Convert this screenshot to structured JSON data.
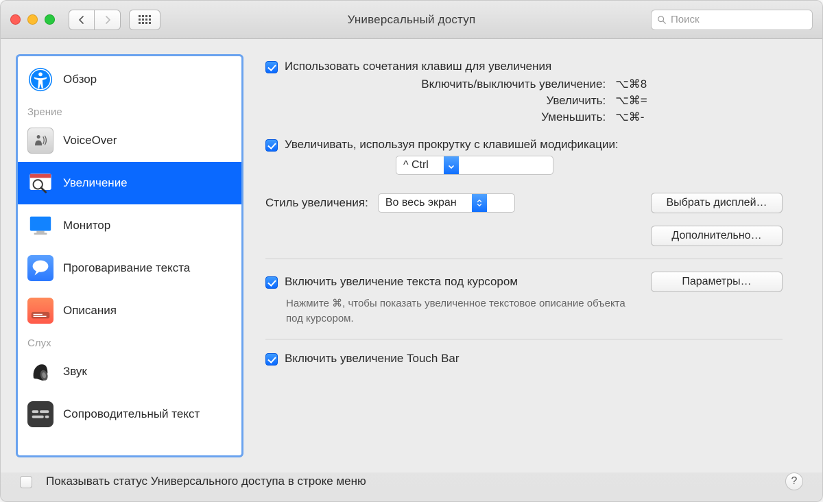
{
  "window": {
    "title": "Универсальный доступ"
  },
  "search": {
    "placeholder": "Поиск"
  },
  "sidebar": {
    "overview": "Обзор",
    "sections": [
      {
        "title": "Зрение",
        "items": [
          "VoiceOver",
          "Увеличение",
          "Монитор",
          "Проговаривание текста",
          "Описания"
        ]
      },
      {
        "title": "Слух",
        "items": [
          "Звук",
          "Сопроводительный текст"
        ]
      }
    ]
  },
  "content": {
    "cb1": "Использовать сочетания клавиш для увеличения",
    "kb": {
      "toggle_lbl": "Включить/выключить увеличение:",
      "toggle_sc": "⌥⌘8",
      "zoomin_lbl": "Увеличить:",
      "zoomin_sc": "⌥⌘=",
      "zoomout_lbl": "Уменьшить:",
      "zoomout_sc": "⌥⌘-"
    },
    "cb2": "Увеличивать, используя прокрутку с клавишей модификации:",
    "mod_select": "^ Ctrl",
    "style_label": "Стиль увеличения:",
    "style_value": "Во весь экран",
    "choose_display": "Выбрать дисплей…",
    "advanced": "Дополнительно…",
    "cb3": "Включить увеличение текста под курсором",
    "options": "Параметры…",
    "hint": "Нажмите ⌘, чтобы показать увеличенное текстовое описание объекта под курсором.",
    "cb4": "Включить увеличение Touch Bar"
  },
  "footer": {
    "status": "Показывать статус Универсального доступа в строке меню"
  }
}
